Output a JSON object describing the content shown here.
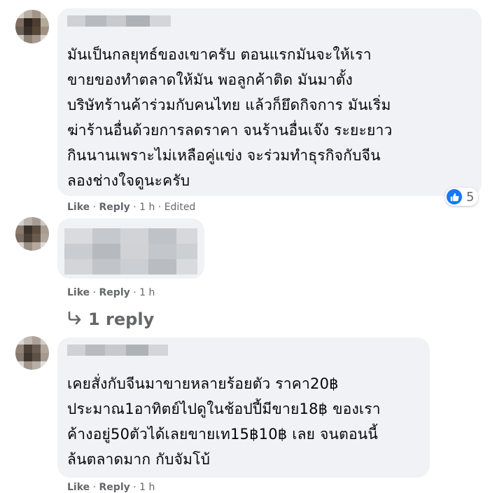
{
  "comments": [
    {
      "lines": "มันเป็นกลยุทธ์ของเขาครับ ตอนแรกมันจะให้เรา\nขายของทำตลาดให้มัน พอลูกค้าติด มันมาตั้ง\nบริษัทร้านค้าร่วมกับคนไทย แล้วก็ยึดกิจการ มันเริ่ม\nฆ่าร้านอื่นด้วยการลดราคา จนร้านอื่นเจ๊ง ระยะยาว\nกินนานเพราะไม่เหลือคู่แข่ง จะร่วมทำธุรกิจกับจีน\nลองช่างใจดูนะครับ",
      "like": "Like",
      "reply": "Reply",
      "time": "1 h",
      "edited": "Edited",
      "reaction_count": "5"
    },
    {
      "like": "Like",
      "reply": "Reply",
      "time": "1 h",
      "replies_label": "1 reply"
    },
    {
      "lines": "เคยสั่งกับจีนมาขายหลายร้อยตัว ราคา20฿\nประมาณ1อาทิตย์ไปดูในช้อปปี้มีขาย18฿ ของเรา\nค้างอยู่50ตัวได้เลยขายเท15฿10฿ เลย จนตอนนี้\nล้นตลาดมาก กับจัมโบ้",
      "like": "Like",
      "reply": "Reply",
      "time": "1 h"
    }
  ],
  "separator": " · ",
  "icons": {
    "reaction": "thumbs-up-icon",
    "reply_arrow": "reply-arrow-icon"
  },
  "colors": {
    "bubble": "#f0f2f5",
    "meta": "#65676b",
    "like_blue": "#1877f2"
  }
}
